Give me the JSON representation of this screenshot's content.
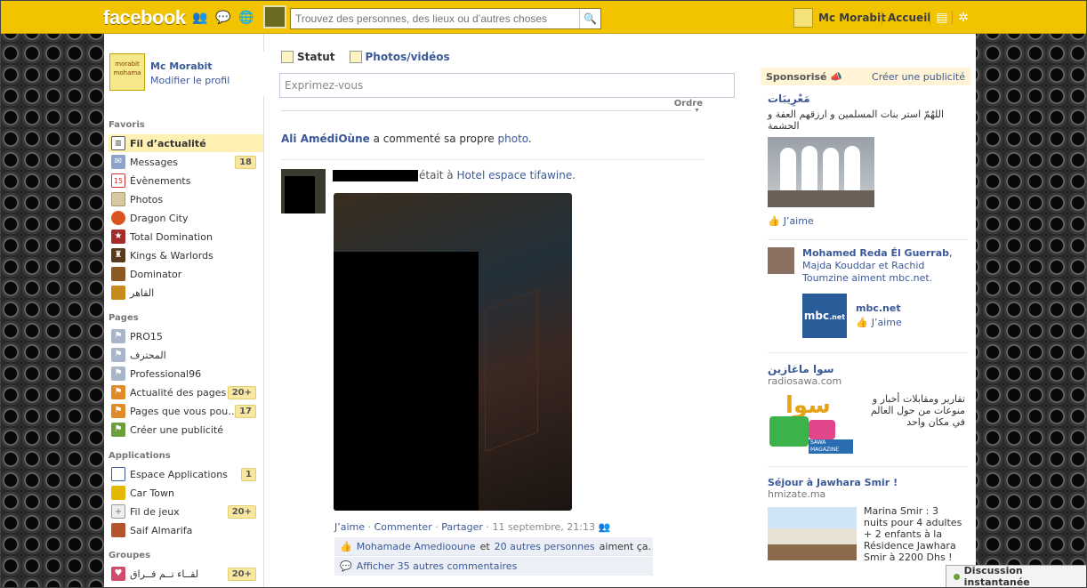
{
  "topbar": {
    "logo": "facebook",
    "search_placeholder": "Trouvez des personnes, des lieux ou d’autres choses",
    "user_name": "Mc Morabit",
    "home_label": "Accueil"
  },
  "left": {
    "profile_name": "Mc Morabit",
    "profile_edit": "Modifier le profil",
    "profile_thumb_text": "morabit mohama",
    "favoris_title": "Favoris",
    "favoris": [
      {
        "label": "Fil d’actualité",
        "badge": ""
      },
      {
        "label": "Messages",
        "badge": "18"
      },
      {
        "label": "Évènements",
        "badge": ""
      },
      {
        "label": "Photos",
        "badge": ""
      },
      {
        "label": "Dragon City",
        "badge": ""
      },
      {
        "label": "Total Domination",
        "badge": ""
      },
      {
        "label": "Kings & Warlords",
        "badge": ""
      },
      {
        "label": "Dominator",
        "badge": ""
      },
      {
        "label": "القاهر",
        "badge": ""
      }
    ],
    "pages_title": "Pages",
    "pages": [
      {
        "label": "PRO15",
        "badge": ""
      },
      {
        "label": "المحترف",
        "badge": ""
      },
      {
        "label": "Professional96",
        "badge": ""
      },
      {
        "label": "Actualité des pages",
        "badge": "20+"
      },
      {
        "label": "Pages que vous pou…",
        "badge": "17"
      },
      {
        "label": "Créer une publicité",
        "badge": ""
      }
    ],
    "apps_title": "Applications",
    "apps": [
      {
        "label": "Espace Applications",
        "badge": "1"
      },
      {
        "label": "Car Town",
        "badge": ""
      },
      {
        "label": "Fil de jeux",
        "badge": "20+"
      },
      {
        "label": "Saif Almarifa",
        "badge": ""
      }
    ],
    "groups_title": "Groupes",
    "groups": [
      {
        "label": "لقــاء تــم فــراق",
        "badge": "20+"
      }
    ]
  },
  "main": {
    "tab_status": "Statut",
    "tab_photos": "Photos/vidéos",
    "composer_placeholder": "Exprimez-vous",
    "order_label": "Ordre",
    "story_actor": "Ali AmédiOùne",
    "story_mid": "a commenté sa propre",
    "story_obj": "photo",
    "post_text": "était à",
    "post_place": "Hotel espace tifawine",
    "action_like": "J’aime",
    "action_comment": "Commenter",
    "action_share": "Partager",
    "post_time": "11 septembre, 21:13",
    "likes_actor": "Mohamade Amediooune",
    "likes_and": "et",
    "likes_others": "20 autres personnes",
    "likes_tail": "aiment ça.",
    "more_comments": "Afficher 35 autres commentaires"
  },
  "right": {
    "sponsored": "Sponsorisé",
    "create_ad": "Créer une publicité",
    "ad1_title": "مَعْرِيبَات",
    "ad1_body": "اللهُمّ استر بنات المسلمين و ارزقهم العفة و الحشمة",
    "ad1_like": "J’aime",
    "social_name": "Mohamed Reda Él Guerrab",
    "social_rest": "Majda Kouddar et Rachid Toumzine aiment mbc.net.",
    "page_name": "mbc.net",
    "page_like": "J’aime",
    "ad2_title": "سوا ماغازين",
    "ad2_url": "radiosawa.com",
    "ad2_body": "تقارير ومقابلات أخبار و منوعات من حول العالم في مكان واحد",
    "ad2_logo_top": "سوا",
    "ad2_logo_sub": "SAWA MAGAZINE",
    "ad3_title": "Séjour à Jawhara Smir !",
    "ad3_url": "hmizate.ma",
    "ad3_body": "Marina Smir : 3 nuits pour 4 adultes + 2 enfants à la Résidence Jawhara Smir à 2200 Dhs !"
  },
  "chat": {
    "label": "Discussion instantanée"
  }
}
